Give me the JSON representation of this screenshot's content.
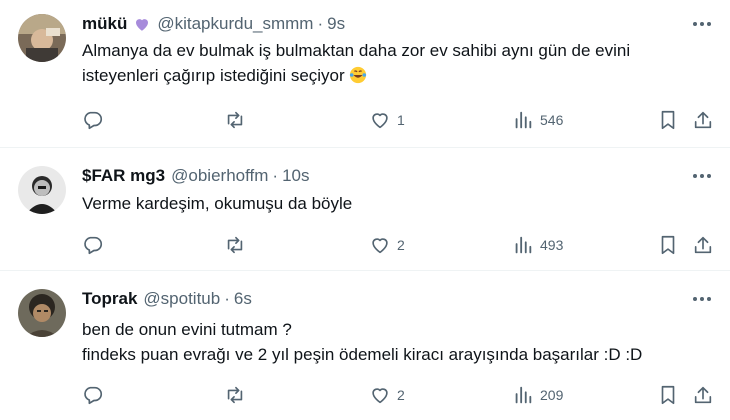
{
  "tweets": [
    {
      "name": "mükü",
      "badge_icon": "purple-heart-icon",
      "handle": "@kitapkurdu_smmm",
      "time": "9s",
      "lines": [
        "Almanya da ev bulmak iş bulmaktan daha zor ev sahibi aynı gün de evini",
        "isteyenleri çağırıp istediğini seçiyor"
      ],
      "emoji": "laughing-tears-emoji",
      "replies": "",
      "retweets": "",
      "likes": "1",
      "views": "546"
    },
    {
      "name": "$FAR mg3",
      "handle": "@obierhoffm",
      "time": "10s",
      "lines": [
        "Verme kardeşim, okumuşu da böyle"
      ],
      "replies": "",
      "retweets": "",
      "likes": "2",
      "views": "493"
    },
    {
      "name": "Toprak",
      "handle": "@spotitub",
      "time": "6s",
      "lines": [
        "ben de onun evini tutmam ?",
        "findeks puan evrağı ve 2 yıl peşin ödemeli kiracı arayışında başarılar :D :D"
      ],
      "replies": "",
      "retweets": "",
      "likes": "2",
      "views": "209"
    }
  ],
  "separator": "·",
  "colors": {
    "text": "#0f1419",
    "muted": "#536471",
    "divider": "#eff3f4",
    "heart_badge": "#a78bdb"
  }
}
